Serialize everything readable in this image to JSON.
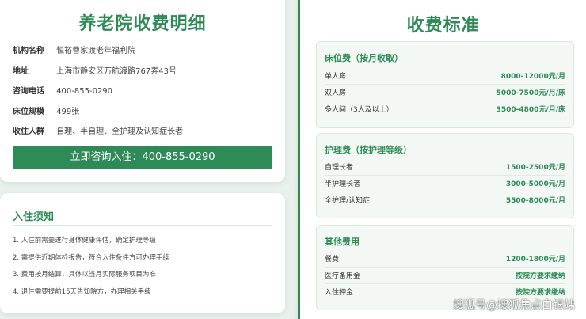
{
  "info": {
    "title": "养老院收费明细",
    "rows": [
      {
        "label": "机构名称",
        "value": "恒裕曹家渡老年福利院"
      },
      {
        "label": "地址",
        "value": "上海市静安区万航渡路767弄43号"
      },
      {
        "label": "咨询电话",
        "value": "400-855-0290"
      },
      {
        "label": "床位规模",
        "value": "499张"
      },
      {
        "label": "收住人群",
        "value": "自理、半自理、全护理及认知症长者"
      }
    ],
    "consult_button": "立即咨询入住：400-855-0290"
  },
  "notice": {
    "title": "入住须知",
    "items": [
      "1. 入住前需要进行身体健康评估，确定护理等级",
      "2. 需提供近期体检报告，符合入住条件方可办理手续",
      "3. 费用按月结算，具体以当月实际服务项目为准",
      "4. 退住需要提前15天告知院方，办理相关手续"
    ]
  },
  "fees": {
    "title": "收费标准",
    "groups": [
      {
        "title": "床位费（按月收取）",
        "rows": [
          {
            "name": "单人房",
            "price": "8000-12000元/月"
          },
          {
            "name": "双人房",
            "price": "5000-7500元/月/床"
          },
          {
            "name": "多人间（3人及以上）",
            "price": "3500-4800元/月/床"
          }
        ]
      },
      {
        "title": "护理费（按护理等级）",
        "rows": [
          {
            "name": "自理长者",
            "price": "1500-2500元/月"
          },
          {
            "name": "半护理长者",
            "price": "3000-5000元/月"
          },
          {
            "name": "全护理/认知症",
            "price": "5500-8000元/月"
          }
        ]
      },
      {
        "title": "其他费用",
        "rows": [
          {
            "name": "餐费",
            "price": "1200-1800元/月"
          },
          {
            "name": "医疗备用金",
            "price": "按院方要求缴纳"
          },
          {
            "name": "入住押金",
            "price": "按院方要求缴纳"
          }
        ]
      }
    ]
  },
  "watermark": "搜狐号@搜狐焦点白银站",
  "colors": {
    "accent": "#2e8b57",
    "background": "#e9f1ec"
  }
}
